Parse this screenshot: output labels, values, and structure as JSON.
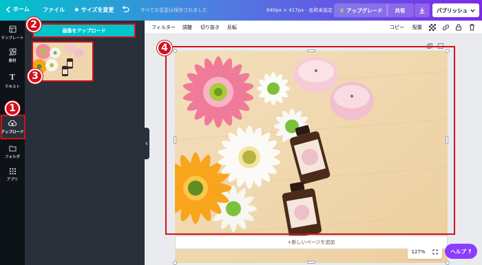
{
  "header": {
    "home": "ホーム",
    "file": "ファイル",
    "resize": "サイズを変更",
    "saved_status": "すべての変更は保存されました",
    "dimensions": "640px × 417px - 名称未設定",
    "upgrade": "アップグレード",
    "share": "共有",
    "publish": "パブリッシュ"
  },
  "rail": {
    "items": [
      {
        "label": "テンプレート",
        "icon": "template-icon"
      },
      {
        "label": "素材",
        "icon": "elements-icon"
      },
      {
        "label": "テキスト",
        "icon": "text-icon"
      },
      {
        "label": "アップロード",
        "icon": "upload-icon",
        "active": true
      },
      {
        "label": "フォルダ",
        "icon": "folder-icon"
      },
      {
        "label": "アプリ",
        "icon": "apps-icon"
      }
    ]
  },
  "panel": {
    "upload_button": "画像をアップロード"
  },
  "toolbar": {
    "filter": "フィルター",
    "adjust": "調整",
    "crop": "切り抜き",
    "flip": "反転",
    "copy": "コピー",
    "position": "配置"
  },
  "canvas": {
    "add_page": "+新しいページを追加",
    "zoom": "127%"
  },
  "help": "ヘルプ",
  "annotations": [
    "1",
    "2",
    "3",
    "4"
  ],
  "colors": {
    "accent": "#00c4cc",
    "annotation": "#d0121b",
    "purple": "#8b3dff"
  }
}
